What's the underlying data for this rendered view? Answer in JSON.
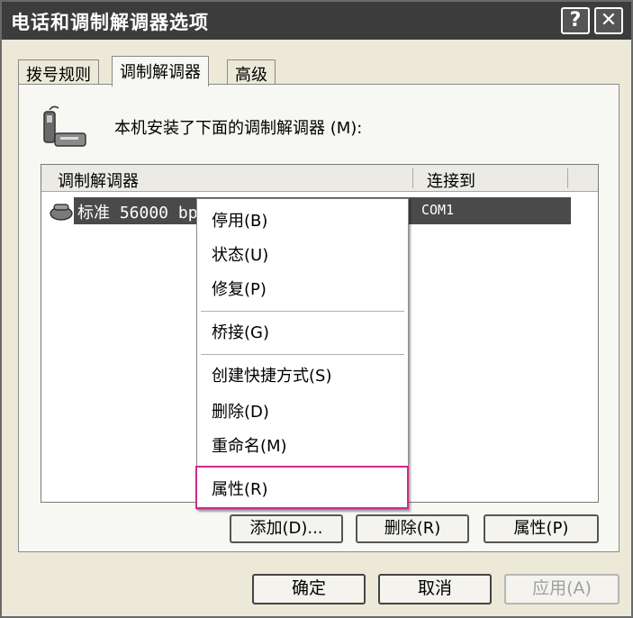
{
  "window": {
    "title": "电话和调制解调器选项",
    "help_label": "?",
    "close_label": "✕"
  },
  "tabs": [
    {
      "label": "拨号规则"
    },
    {
      "label": "调制解调器"
    },
    {
      "label": "高级"
    }
  ],
  "active_tab": "调制解调器",
  "panel": {
    "intro_text": "本机安装了下面的调制解调器 (M):",
    "columns": [
      "调制解调器",
      "连接到"
    ],
    "rows": [
      {
        "name": "标准 56000 bp",
        "port": "COM1"
      }
    ],
    "buttons": {
      "add": "添加(D)...",
      "remove": "删除(R)",
      "properties": "属性(P)"
    }
  },
  "context_menu": {
    "items": [
      "停用(B)",
      "状态(U)",
      "修复(P)",
      "桥接(G)",
      "创建快捷方式(S)",
      "删除(D)",
      "重命名(M)",
      "属性(R)"
    ],
    "highlighted_item": "属性(R)",
    "highlight_color": "#cc2a8f"
  },
  "dialog_buttons": {
    "ok": "确定",
    "cancel": "取消",
    "apply": "应用(A)"
  }
}
